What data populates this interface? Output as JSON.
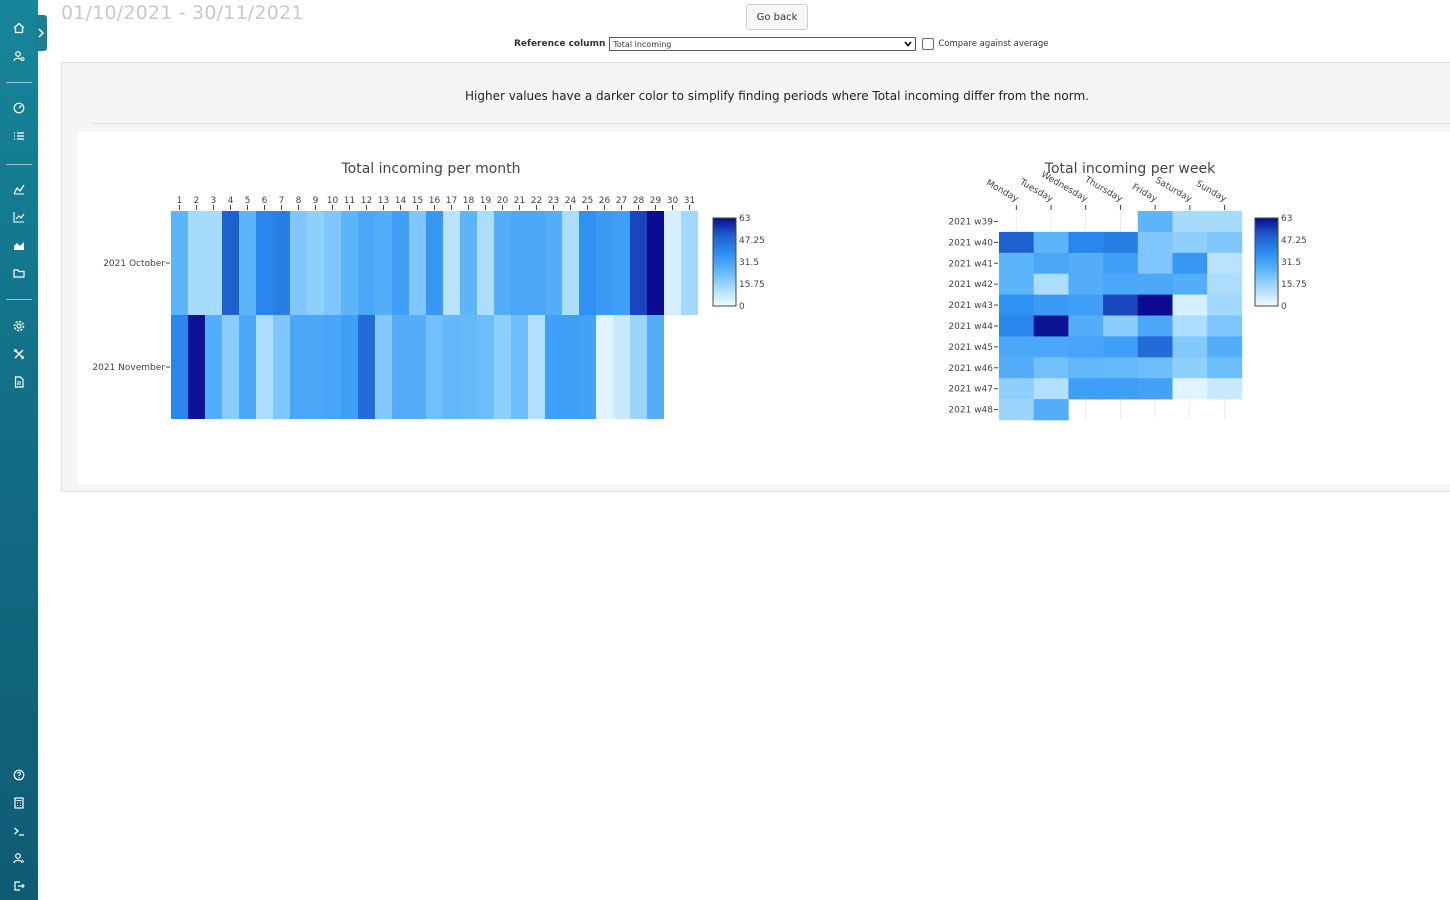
{
  "header": {
    "date_range": "01/10/2021 - 30/11/2021",
    "go_back_label": "Go back"
  },
  "controls": {
    "reference_label": "Reference column",
    "reference_value": "Total incoming",
    "compare_label": "Compare against average",
    "compare_checked": false
  },
  "hint_text": "Higher values have a darker color to simplify finding periods where Total incoming differ from the norm.",
  "sidebar": {
    "top_icons": [
      "home-icon",
      "user-settings-icon"
    ],
    "group2_icons": [
      "dashboard-icon",
      "list-icon"
    ],
    "group3_icons": [
      "analytics-icon",
      "line-chart-icon",
      "area-chart-icon",
      "folder-icon"
    ],
    "group4_icons": [
      "gear-icon",
      "tools-icon",
      "document-icon"
    ],
    "bottom_icons": [
      "help-icon",
      "calculator-icon",
      "terminal-icon",
      "user-icon",
      "logout-icon"
    ]
  },
  "colors": {
    "scale": [
      "#f0fbff",
      "#a9dcfc",
      "#5fb6fa",
      "#2b8ff2",
      "#1f5ecf",
      "#0a0b8f"
    ],
    "sidebar": "#126f86"
  },
  "chart_data": [
    {
      "type": "heatmap",
      "title": "Total incoming per month",
      "x": [
        "1",
        "2",
        "3",
        "4",
        "5",
        "6",
        "7",
        "8",
        "9",
        "10",
        "11",
        "12",
        "13",
        "14",
        "15",
        "16",
        "17",
        "18",
        "19",
        "20",
        "21",
        "22",
        "23",
        "24",
        "25",
        "26",
        "27",
        "28",
        "29",
        "30",
        "31"
      ],
      "y": [
        "2021 October",
        "2021 November"
      ],
      "values": [
        [
          26,
          13,
          13,
          50,
          26,
          40,
          42,
          20,
          17,
          20,
          26,
          30,
          28,
          33,
          20,
          35,
          10,
          26,
          12,
          28,
          30,
          30,
          28,
          12,
          37,
          34,
          33,
          54,
          63,
          5,
          14
        ],
        [
          40,
          62,
          28,
          18,
          30,
          12,
          20,
          30,
          30,
          31,
          33,
          47,
          19,
          28,
          28,
          22,
          25,
          24,
          23,
          17,
          23,
          11,
          33,
          33,
          32,
          3,
          7,
          15,
          28,
          null,
          null
        ]
      ],
      "colorbar": {
        "min": 0,
        "max": 63,
        "ticks": [
          "63",
          "47.25",
          "31.5",
          "15.75",
          "0"
        ]
      }
    },
    {
      "type": "heatmap",
      "title": "Total incoming per week",
      "x": [
        "Monday",
        "Tuesday",
        "Wednesday",
        "Thursday",
        "Friday",
        "Saturday",
        "Sunday"
      ],
      "y": [
        "2021 w39",
        "2021 w40",
        "2021 w41",
        "2021 w42",
        "2021 w43",
        "2021 w44",
        "2021 w45",
        "2021 w46",
        "2021 w47",
        "2021 w48"
      ],
      "values": [
        [
          null,
          null,
          null,
          null,
          26,
          13,
          13
        ],
        [
          50,
          26,
          40,
          42,
          20,
          17,
          20
        ],
        [
          26,
          30,
          28,
          33,
          20,
          35,
          10
        ],
        [
          26,
          12,
          28,
          30,
          30,
          28,
          12
        ],
        [
          37,
          34,
          33,
          54,
          63,
          5,
          14
        ],
        [
          40,
          62,
          28,
          18,
          30,
          12,
          20
        ],
        [
          30,
          30,
          31,
          33,
          47,
          19,
          28
        ],
        [
          28,
          22,
          25,
          24,
          23,
          17,
          23
        ],
        [
          17,
          11,
          33,
          33,
          32,
          3,
          7
        ],
        [
          15,
          28,
          null,
          null,
          null,
          null,
          null
        ]
      ],
      "colorbar": {
        "min": 0,
        "max": 63,
        "ticks": [
          "63",
          "47.25",
          "31.5",
          "15.75",
          "0"
        ]
      }
    }
  ]
}
